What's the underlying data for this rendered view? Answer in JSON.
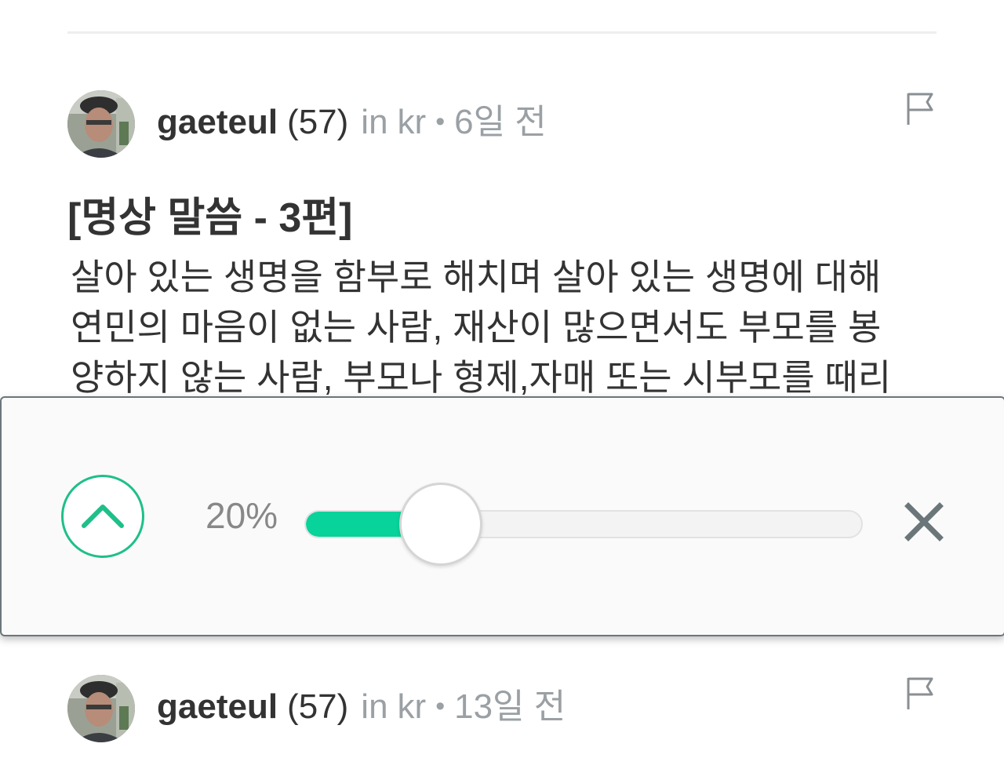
{
  "posts": [
    {
      "author": "gaeteul",
      "reputation": "(57)",
      "in_word": "in",
      "category": "kr",
      "dot": "•",
      "time": "6일 전",
      "title": "[명상 말씀 - 3편]",
      "body_lines": [
        "살아 있는 생명을 함부로 해치며 살아 있는 생명에 대해",
        "연민의 마음이 없는 사람, 재산이 많으면서도 부모를 봉",
        "양하지 않는 사람, 부모나 형제,자매 또는 시부모를 때리"
      ]
    },
    {
      "author": "gaeteul",
      "reputation": "(57)",
      "in_word": "in",
      "category": "kr",
      "dot": "•",
      "time": "13일 전"
    }
  ],
  "icons": {
    "flag": "flag-icon",
    "collapse": "chevron-up-icon",
    "close": "close-icon",
    "avatar": "avatar"
  },
  "slider": {
    "label": "20%",
    "value": 0.2
  },
  "colors": {
    "accent": "#07d39a",
    "accent_border": "#1fbf8a",
    "meta_gray": "#9aa0a4",
    "text": "#333333",
    "close_icon": "#6b767a"
  }
}
